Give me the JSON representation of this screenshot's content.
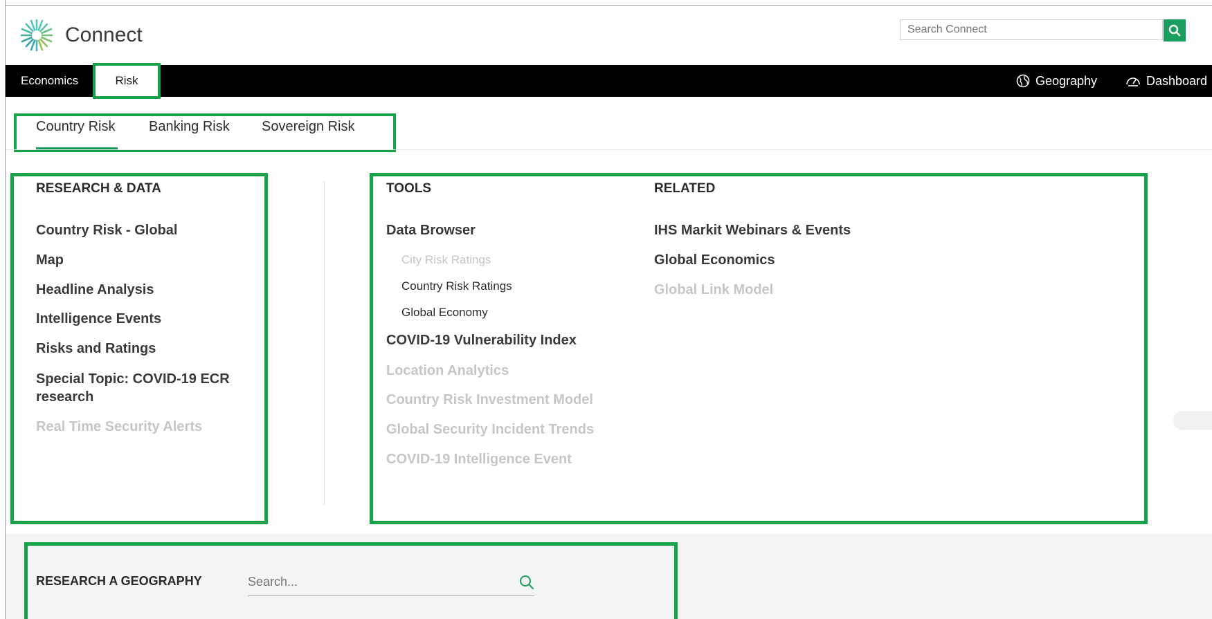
{
  "header": {
    "brand": "Connect",
    "search_placeholder": "Search Connect"
  },
  "topnav": {
    "items": [
      {
        "label": "Economics"
      },
      {
        "label": "Risk"
      }
    ],
    "right": [
      {
        "label": "Geography",
        "icon": "globe-icon"
      },
      {
        "label": "Dashboard",
        "icon": "dashboard-icon"
      }
    ]
  },
  "subtabs": [
    {
      "label": "Country Risk",
      "active": true
    },
    {
      "label": "Banking Risk"
    },
    {
      "label": "Sovereign Risk"
    }
  ],
  "research": {
    "heading": "RESEARCH & DATA",
    "items": [
      {
        "label": "Country Risk - Global"
      },
      {
        "label": "Map"
      },
      {
        "label": "Headline Analysis"
      },
      {
        "label": "Intelligence Events"
      },
      {
        "label": "Risks and Ratings"
      },
      {
        "label": "Special Topic: COVID-19 ECR"
      },
      {
        "label": "research"
      },
      {
        "label": "Real Time Security Alerts",
        "disabled": true
      }
    ]
  },
  "tools": {
    "heading": "TOOLS",
    "data_browser": "Data Browser",
    "sub": [
      {
        "label": "City Risk Ratings",
        "disabled": true
      },
      {
        "label": "Country Risk Ratings"
      },
      {
        "label": "Global Economy"
      }
    ],
    "items": [
      {
        "label": "COVID-19 Vulnerability Index"
      },
      {
        "label": "Location Analytics",
        "disabled": true
      },
      {
        "label": "Country Risk Investment Model",
        "disabled": true
      },
      {
        "label": "Global Security Incident Trends",
        "disabled": true
      },
      {
        "label": "COVID-19 Intelligence Event",
        "disabled": true
      }
    ]
  },
  "related": {
    "heading": "RELATED",
    "items": [
      {
        "label": "IHS Markit Webinars & Events"
      },
      {
        "label": "Global Economics"
      },
      {
        "label": "Global Link Model",
        "disabled": true
      }
    ]
  },
  "geography": {
    "label": "RESEARCH A GEOGRAPHY",
    "placeholder": "Search..."
  },
  "colors": {
    "accent": "#1a9e5f",
    "highlight_box": "#16a34a",
    "nav_bg": "#000000",
    "disabled_text": "#c6c6c6"
  }
}
